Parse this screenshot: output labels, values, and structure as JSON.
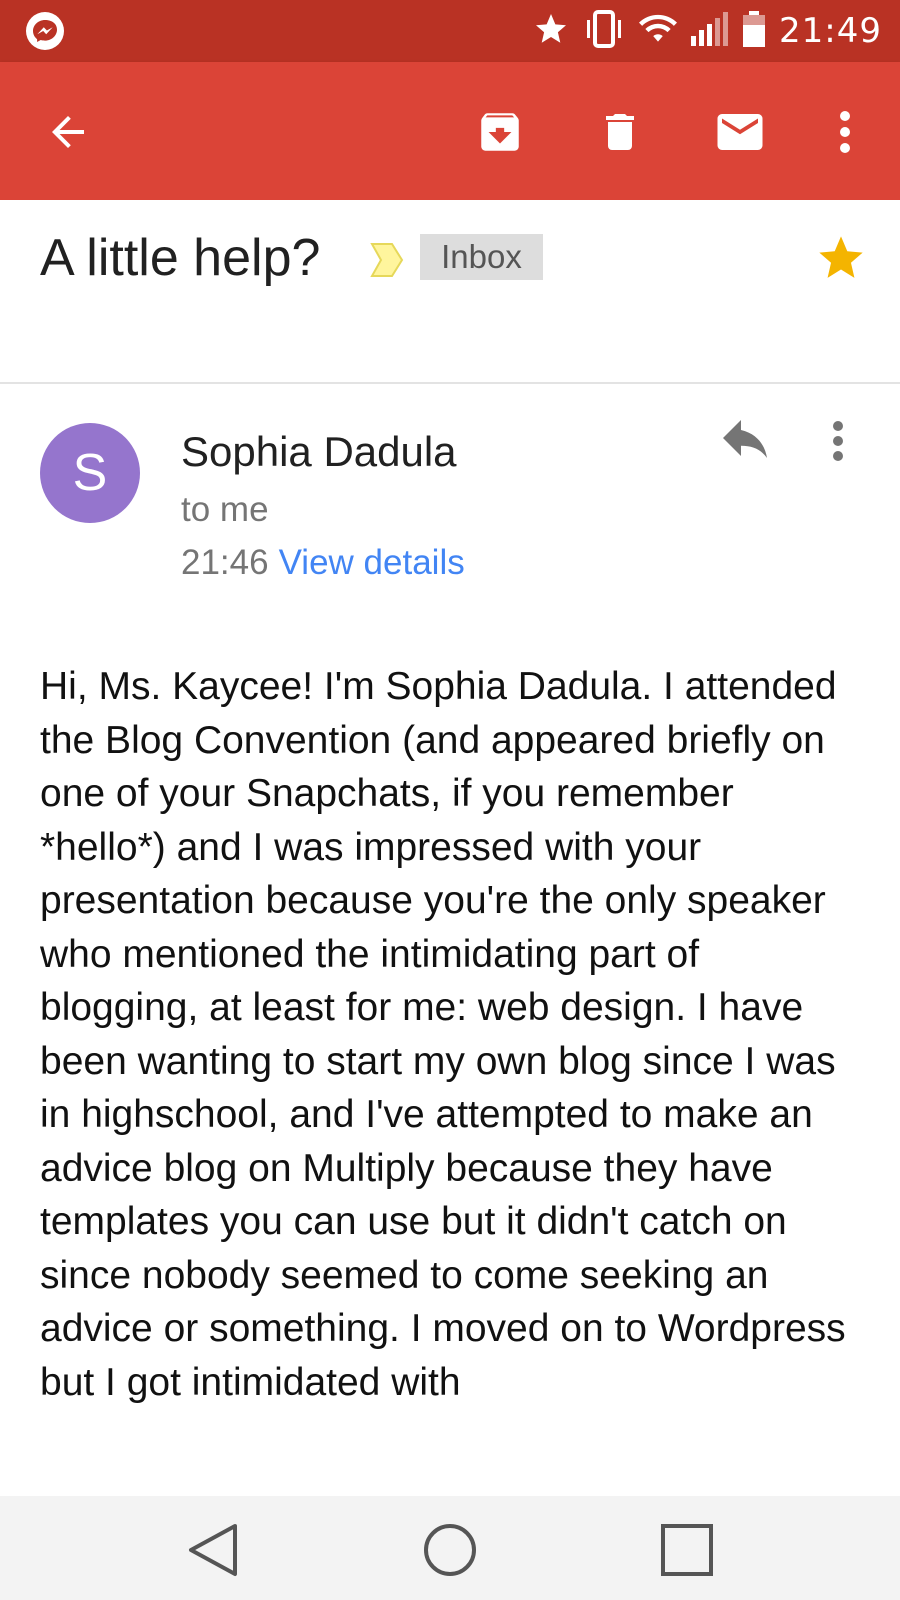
{
  "status_bar": {
    "time": "21:49",
    "icons": [
      "messenger-icon",
      "star-icon",
      "vibrate-icon",
      "wifi-icon",
      "signal-icon",
      "battery-icon"
    ]
  },
  "toolbar": {
    "icons": [
      "back-arrow-icon",
      "archive-icon",
      "delete-icon",
      "mark-unread-icon",
      "more-vert-icon"
    ]
  },
  "email": {
    "subject": "A little help?",
    "label": "Inbox",
    "starred": true,
    "sender": {
      "initial": "S",
      "name": "Sophia Dadula",
      "recipient": "to me",
      "time": "21:46",
      "details_link": "View details"
    },
    "body": "Hi, Ms. Kaycee! I'm Sophia Dadula. I attended the Blog Convention (and appeared briefly on one of your Snapchats, if you remember *hello*) and I was impressed with your presentation because you're the only speaker who mentioned the intimidating part of blogging, at least for me: web design. I have been wanting to start my own blog since I was in highschool, and I've attempted to make an advice blog on Multiply because they have templates you can use but it didn't catch on since nobody seemed to come seeking an advice or something. I moved on to Wordpress but I got intimidated with"
  },
  "colors": {
    "status_bar": "#b93224",
    "app_bar": "#db4437",
    "avatar": "#9575cd",
    "star": "#f4b400",
    "link": "#4285f4"
  },
  "nav_bar": {
    "icons": [
      "nav-back-icon",
      "nav-home-icon",
      "nav-recents-icon"
    ]
  }
}
